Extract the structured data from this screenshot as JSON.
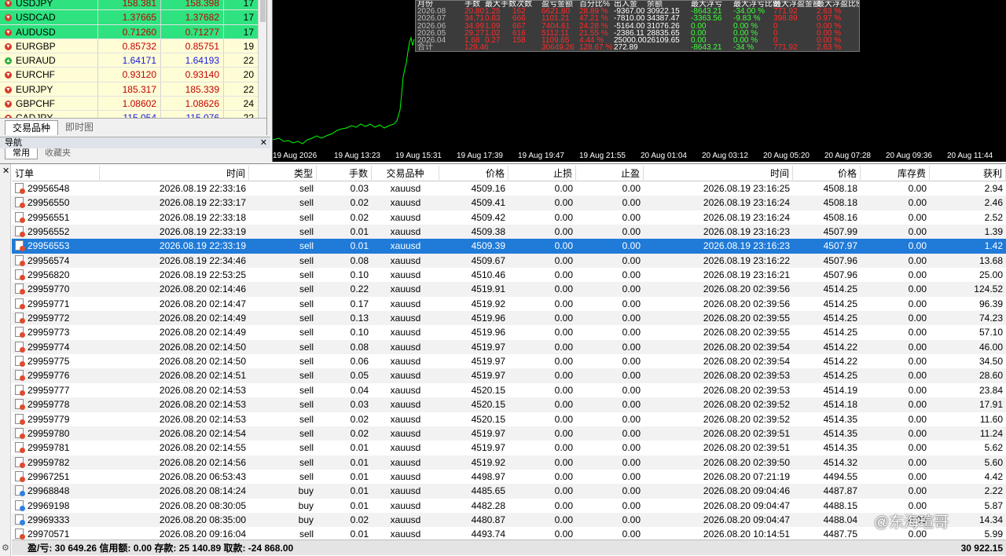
{
  "market_watch": {
    "rows": [
      {
        "symbol": "USDJPY",
        "bid": "158.381",
        "ask": "158.398",
        "spread": "17",
        "style": "green",
        "dir": "down",
        "color": "red"
      },
      {
        "symbol": "USDCAD",
        "bid": "1.37665",
        "ask": "1.37682",
        "spread": "17",
        "style": "green",
        "dir": "down",
        "color": "red"
      },
      {
        "symbol": "AUDUSD",
        "bid": "0.71260",
        "ask": "0.71277",
        "spread": "17",
        "style": "green",
        "dir": "down",
        "color": "red"
      },
      {
        "symbol": "EURGBP",
        "bid": "0.85732",
        "ask": "0.85751",
        "spread": "19",
        "style": "yel",
        "dir": "down",
        "color": "red"
      },
      {
        "symbol": "EURAUD",
        "bid": "1.64171",
        "ask": "1.64193",
        "spread": "22",
        "style": "yel",
        "dir": "up",
        "color": "blue"
      },
      {
        "symbol": "EURCHF",
        "bid": "0.93120",
        "ask": "0.93140",
        "spread": "20",
        "style": "yel",
        "dir": "down",
        "color": "red"
      },
      {
        "symbol": "EURJPY",
        "bid": "185.317",
        "ask": "185.339",
        "spread": "22",
        "style": "yel",
        "dir": "down",
        "color": "red"
      },
      {
        "symbol": "GBPCHF",
        "bid": "1.08602",
        "ask": "1.08626",
        "spread": "24",
        "style": "yel",
        "dir": "down",
        "color": "red"
      },
      {
        "symbol": "CADJPY",
        "bid": "115.054",
        "ask": "115.076",
        "spread": "22",
        "style": "yel",
        "dir": "down",
        "color": "blue"
      }
    ],
    "tabs": [
      "交易品种",
      "即时图"
    ]
  },
  "navigator": {
    "title": "导航",
    "tabs": [
      "常用",
      "收藏夹"
    ]
  },
  "chart": {
    "x_ticks": [
      "19 Aug 2026",
      "19 Aug 13:23",
      "19 Aug 15:31",
      "19 Aug 17:39",
      "19 Aug 19:47",
      "19 Aug 21:55",
      "20 Aug 01:04",
      "20 Aug 03:12",
      "20 Aug 05:20",
      "20 Aug 07:28",
      "20 Aug 09:36",
      "20 Aug 11:44"
    ],
    "line_color": "#00ff00",
    "stats": {
      "headers": [
        "月份",
        "手数",
        "最大手数次数",
        "盈亏金额",
        "百分比%",
        "出入金",
        "余额",
        "最大浮亏",
        "最大浮亏比例",
        "最大浮盈金额",
        "最大浮盈比例"
      ],
      "rows": [
        [
          "2026.08",
          "20.80",
          "1.25",
          "162",
          "6621.80",
          "28.89 %",
          "-9367.00",
          "30922.15",
          "-8643.21",
          "-34.00 %",
          "771.92",
          "2.63 %"
        ],
        [
          "2026.07",
          "34.71",
          "0.83",
          "666",
          "1101.21",
          "47.21 %",
          "-7810.00",
          "34387.47",
          "-3363.56",
          "-9.83 %",
          "398.89",
          "0.97 %"
        ],
        [
          "2026.06",
          "34.99",
          "1.09",
          "667",
          "7404.61",
          "24.28 %",
          "-5164.00",
          "31076.26",
          "0.00",
          "0.00 %",
          "0",
          "0.00 %"
        ],
        [
          "2026.05",
          "29.27",
          "1.02",
          "616",
          "5112.11",
          "21.55 %",
          "-2386.11",
          "28835.65",
          "0.00",
          "0.00 %",
          "0",
          "0.00 %"
        ],
        [
          "2026.04",
          "1.68",
          "0.27",
          "158",
          "1109.65",
          "4.44 %",
          "25000.00",
          "26109.65",
          "0.00",
          "0.00 %",
          "0",
          "0.00 %"
        ],
        [
          "合计",
          "129.46",
          "",
          "",
          "30649.26",
          "128.67 %",
          "272.89",
          "",
          "-8643.21",
          "-34 %",
          "771.92",
          "2.63 %"
        ]
      ]
    }
  },
  "terminal": {
    "columns": [
      "订单",
      "时间",
      "类型",
      "手数",
      "交易品种",
      "价格",
      "止损",
      "止盈",
      "时间",
      "价格",
      "库存费",
      "获利"
    ],
    "rows": [
      [
        "29956548",
        "2026.08.19 22:33:16",
        "sell",
        "0.03",
        "xauusd",
        "4509.16",
        "0.00",
        "0.00",
        "2026.08.19 23:16:25",
        "4508.18",
        "0.00",
        "2.94"
      ],
      [
        "29956550",
        "2026.08.19 22:33:17",
        "sell",
        "0.02",
        "xauusd",
        "4509.41",
        "0.00",
        "0.00",
        "2026.08.19 23:16:24",
        "4508.18",
        "0.00",
        "2.46"
      ],
      [
        "29956551",
        "2026.08.19 22:33:18",
        "sell",
        "0.02",
        "xauusd",
        "4509.42",
        "0.00",
        "0.00",
        "2026.08.19 23:16:24",
        "4508.16",
        "0.00",
        "2.52"
      ],
      [
        "29956552",
        "2026.08.19 22:33:19",
        "sell",
        "0.01",
        "xauusd",
        "4509.38",
        "0.00",
        "0.00",
        "2026.08.19 23:16:23",
        "4507.99",
        "0.00",
        "1.39"
      ],
      [
        "29956553",
        "2026.08.19 22:33:19",
        "sell",
        "0.01",
        "xauusd",
        "4509.39",
        "0.00",
        "0.00",
        "2026.08.19 23:16:23",
        "4507.97",
        "0.00",
        "1.42"
      ],
      [
        "29956574",
        "2026.08.19 22:34:46",
        "sell",
        "0.08",
        "xauusd",
        "4509.67",
        "0.00",
        "0.00",
        "2026.08.19 23:16:22",
        "4507.96",
        "0.00",
        "13.68"
      ],
      [
        "29956820",
        "2026.08.19 22:53:25",
        "sell",
        "0.10",
        "xauusd",
        "4510.46",
        "0.00",
        "0.00",
        "2026.08.19 23:16:21",
        "4507.96",
        "0.00",
        "25.00"
      ],
      [
        "29959770",
        "2026.08.20 02:14:46",
        "sell",
        "0.22",
        "xauusd",
        "4519.91",
        "0.00",
        "0.00",
        "2026.08.20 02:39:56",
        "4514.25",
        "0.00",
        "124.52"
      ],
      [
        "29959771",
        "2026.08.20 02:14:47",
        "sell",
        "0.17",
        "xauusd",
        "4519.92",
        "0.00",
        "0.00",
        "2026.08.20 02:39:56",
        "4514.25",
        "0.00",
        "96.39"
      ],
      [
        "29959772",
        "2026.08.20 02:14:49",
        "sell",
        "0.13",
        "xauusd",
        "4519.96",
        "0.00",
        "0.00",
        "2026.08.20 02:39:55",
        "4514.25",
        "0.00",
        "74.23"
      ],
      [
        "29959773",
        "2026.08.20 02:14:49",
        "sell",
        "0.10",
        "xauusd",
        "4519.96",
        "0.00",
        "0.00",
        "2026.08.20 02:39:55",
        "4514.25",
        "0.00",
        "57.10"
      ],
      [
        "29959774",
        "2026.08.20 02:14:50",
        "sell",
        "0.08",
        "xauusd",
        "4519.97",
        "0.00",
        "0.00",
        "2026.08.20 02:39:54",
        "4514.22",
        "0.00",
        "46.00"
      ],
      [
        "29959775",
        "2026.08.20 02:14:50",
        "sell",
        "0.06",
        "xauusd",
        "4519.97",
        "0.00",
        "0.00",
        "2026.08.20 02:39:54",
        "4514.22",
        "0.00",
        "34.50"
      ],
      [
        "29959776",
        "2026.08.20 02:14:51",
        "sell",
        "0.05",
        "xauusd",
        "4519.97",
        "0.00",
        "0.00",
        "2026.08.20 02:39:53",
        "4514.25",
        "0.00",
        "28.60"
      ],
      [
        "29959777",
        "2026.08.20 02:14:53",
        "sell",
        "0.04",
        "xauusd",
        "4520.15",
        "0.00",
        "0.00",
        "2026.08.20 02:39:53",
        "4514.19",
        "0.00",
        "23.84"
      ],
      [
        "29959778",
        "2026.08.20 02:14:53",
        "sell",
        "0.03",
        "xauusd",
        "4520.15",
        "0.00",
        "0.00",
        "2026.08.20 02:39:52",
        "4514.18",
        "0.00",
        "17.91"
      ],
      [
        "29959779",
        "2026.08.20 02:14:53",
        "sell",
        "0.02",
        "xauusd",
        "4520.15",
        "0.00",
        "0.00",
        "2026.08.20 02:39:52",
        "4514.35",
        "0.00",
        "11.60"
      ],
      [
        "29959780",
        "2026.08.20 02:14:54",
        "sell",
        "0.02",
        "xauusd",
        "4519.97",
        "0.00",
        "0.00",
        "2026.08.20 02:39:51",
        "4514.35",
        "0.00",
        "11.24"
      ],
      [
        "29959781",
        "2026.08.20 02:14:55",
        "sell",
        "0.01",
        "xauusd",
        "4519.97",
        "0.00",
        "0.00",
        "2026.08.20 02:39:51",
        "4514.35",
        "0.00",
        "5.62"
      ],
      [
        "29959782",
        "2026.08.20 02:14:56",
        "sell",
        "0.01",
        "xauusd",
        "4519.92",
        "0.00",
        "0.00",
        "2026.08.20 02:39:50",
        "4514.32",
        "0.00",
        "5.60"
      ],
      [
        "29967251",
        "2026.08.20 06:53:43",
        "sell",
        "0.01",
        "xauusd",
        "4498.97",
        "0.00",
        "0.00",
        "2026.08.20 07:21:19",
        "4494.55",
        "0.00",
        "4.42"
      ],
      [
        "29968848",
        "2026.08.20 08:14:24",
        "buy",
        "0.01",
        "xauusd",
        "4485.65",
        "0.00",
        "0.00",
        "2026.08.20 09:04:46",
        "4487.87",
        "0.00",
        "2.22"
      ],
      [
        "29969198",
        "2026.08.20 08:30:05",
        "buy",
        "0.01",
        "xauusd",
        "4482.28",
        "0.00",
        "0.00",
        "2026.08.20 09:04:47",
        "4488.15",
        "0.00",
        "5.87"
      ],
      [
        "29969333",
        "2026.08.20 08:35:00",
        "buy",
        "0.02",
        "xauusd",
        "4480.87",
        "0.00",
        "0.00",
        "2026.08.20 09:04:47",
        "4488.04",
        "0.00",
        "14.34"
      ],
      [
        "29970571",
        "2026.08.20 09:16:04",
        "sell",
        "0.01",
        "xauusd",
        "4493.74",
        "0.00",
        "0.00",
        "2026.08.20 10:14:51",
        "4487.75",
        "0.00",
        "5.99"
      ]
    ],
    "selected_row": 4,
    "footer_left": "盈/亏: 30 649.26  信用额: 0.00  存款: 25 140.89  取款: -24 868.00",
    "footer_right": "30 922.15"
  },
  "watermark": "@东海瑄哥"
}
